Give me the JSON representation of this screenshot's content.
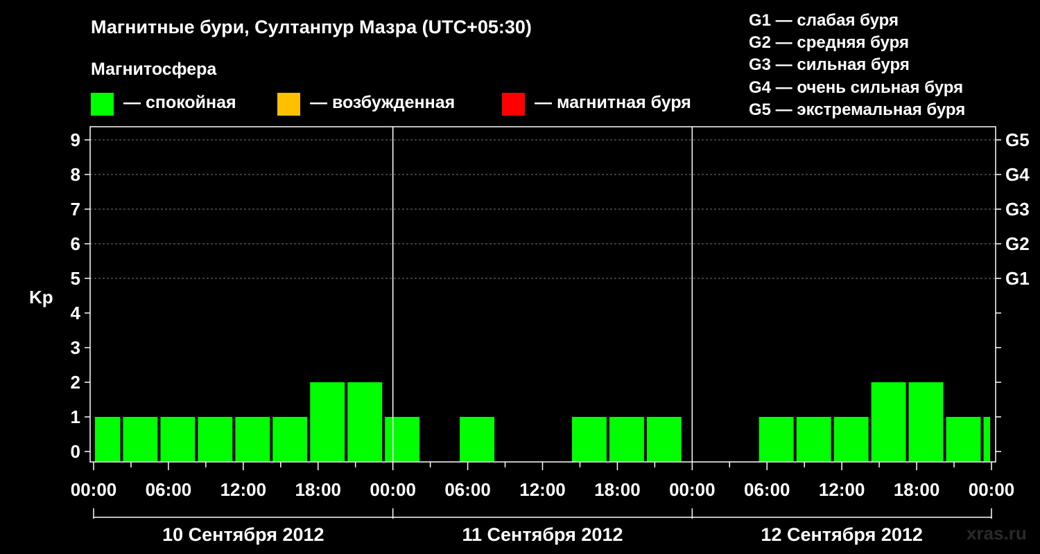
{
  "title": "Магнитные бури, Султанпур Мазра (UTC+05:30)",
  "legend": {
    "title": "Магнитосфера",
    "items": [
      {
        "label": "— спокойная",
        "color": "#00ff00"
      },
      {
        "label": "— возбужденная",
        "color": "#ffc000"
      },
      {
        "label": "— магнитная буря",
        "color": "#ff0000"
      }
    ]
  },
  "g_scale": [
    "G1 — слабая буря",
    "G2 — средняя буря",
    "G3 — сильная буря",
    "G4 — очень сильная буря",
    "G5 — экстремальная буря"
  ],
  "watermark": "xras.ru",
  "chart_data": {
    "type": "bar",
    "ylabel": "Kp",
    "ylim": [
      0,
      9
    ],
    "yticks": [
      0,
      1,
      2,
      3,
      4,
      5,
      6,
      7,
      8,
      9
    ],
    "right_axis_labels": [
      {
        "kp": 5,
        "label": "G1"
      },
      {
        "kp": 6,
        "label": "G2"
      },
      {
        "kp": 7,
        "label": "G3"
      },
      {
        "kp": 8,
        "label": "G4"
      },
      {
        "kp": 9,
        "label": "G5"
      }
    ],
    "xlim_hours": [
      0,
      72
    ],
    "xtick_labels": [
      "00:00",
      "06:00",
      "12:00",
      "18:00",
      "00:00",
      "06:00",
      "12:00",
      "18:00",
      "00:00",
      "06:00",
      "12:00",
      "18:00",
      "00:00"
    ],
    "days": [
      "10 Сентября 2012",
      "11 Сентября 2012",
      "12 Сентября 2012"
    ],
    "grid": "horizontal dashed at Kp 5–9",
    "bar_color": "#00ff00",
    "bars": [
      {
        "start": 0,
        "end": 2.25,
        "kp": 1
      },
      {
        "start": 2.25,
        "end": 5.25,
        "kp": 1
      },
      {
        "start": 5.25,
        "end": 8.25,
        "kp": 1
      },
      {
        "start": 8.25,
        "end": 11.25,
        "kp": 1
      },
      {
        "start": 11.25,
        "end": 14.25,
        "kp": 1
      },
      {
        "start": 14.25,
        "end": 17.25,
        "kp": 1
      },
      {
        "start": 17.25,
        "end": 20.25,
        "kp": 2
      },
      {
        "start": 20.25,
        "end": 23.25,
        "kp": 2
      },
      {
        "start": 23.25,
        "end": 26.25,
        "kp": 1
      },
      {
        "start": 26.25,
        "end": 29.25,
        "kp": 0
      },
      {
        "start": 29.25,
        "end": 32.25,
        "kp": 1
      },
      {
        "start": 32.25,
        "end": 35.25,
        "kp": 0
      },
      {
        "start": 35.25,
        "end": 38.25,
        "kp": 0
      },
      {
        "start": 38.25,
        "end": 41.25,
        "kp": 1
      },
      {
        "start": 41.25,
        "end": 44.25,
        "kp": 1
      },
      {
        "start": 44.25,
        "end": 47.25,
        "kp": 1
      },
      {
        "start": 47.25,
        "end": 50.25,
        "kp": 0
      },
      {
        "start": 50.25,
        "end": 53.25,
        "kp": 0
      },
      {
        "start": 53.25,
        "end": 56.25,
        "kp": 1
      },
      {
        "start": 56.25,
        "end": 59.25,
        "kp": 1
      },
      {
        "start": 59.25,
        "end": 62.25,
        "kp": 1
      },
      {
        "start": 62.25,
        "end": 65.25,
        "kp": 2
      },
      {
        "start": 65.25,
        "end": 68.25,
        "kp": 2
      },
      {
        "start": 68.25,
        "end": 71.25,
        "kp": 1
      },
      {
        "start": 71.25,
        "end": 72,
        "kp": 1
      }
    ]
  }
}
